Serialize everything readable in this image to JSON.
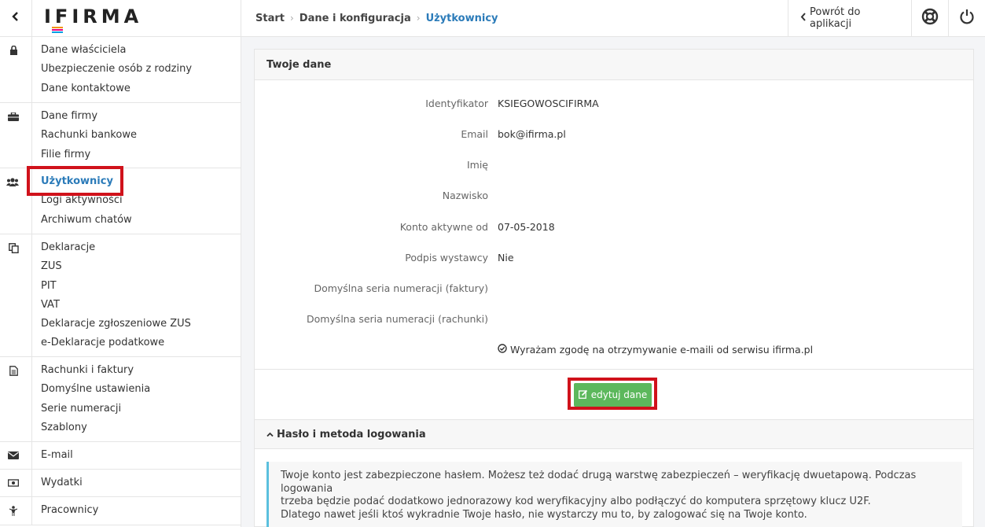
{
  "header": {
    "logo": "IFIRMA",
    "breadcrumb": [
      "Start",
      "Dane i konfiguracja",
      "Użytkownicy"
    ],
    "back_to_app": "Powrót do aplikacji"
  },
  "sidebar": {
    "groups": [
      {
        "icon": "lock-icon",
        "items": [
          "Dane właściciela",
          "Ubezpieczenie osób z rodziny",
          "Dane kontaktowe"
        ]
      },
      {
        "icon": "briefcase-icon",
        "items": [
          "Dane firmy",
          "Rachunki bankowe",
          "Filie firmy"
        ]
      },
      {
        "icon": "users-icon",
        "items": [
          "Użytkownicy",
          "Logi aktywności",
          "Archiwum chatów"
        ]
      },
      {
        "icon": "copy-icon",
        "items": [
          "Deklaracje",
          "ZUS",
          "PIT",
          "VAT",
          "Deklaracje zgłoszeniowe ZUS",
          "e-Deklaracje podatkowe"
        ]
      },
      {
        "icon": "document-icon",
        "items": [
          "Rachunki i faktury",
          "Domyślne ustawienia",
          "Serie numeracji",
          "Szablony"
        ]
      },
      {
        "icon": "envelope-icon",
        "items": [
          "E-mail"
        ]
      },
      {
        "icon": "money-icon",
        "items": [
          "Wydatki"
        ]
      },
      {
        "icon": "person-icon",
        "items": [
          "Pracownicy"
        ]
      }
    ]
  },
  "main": {
    "title": "Twoje dane",
    "fields": [
      {
        "label": "Identyfikator",
        "value": "KSIEGOWOSCIFIRMA"
      },
      {
        "label": "Email",
        "value": "bok@ifirma.pl"
      },
      {
        "label": "Imię",
        "value": ""
      },
      {
        "label": "Nazwisko",
        "value": ""
      },
      {
        "label": "Konto aktywne od",
        "value": "07-05-2018"
      },
      {
        "label": "Podpis wystawcy",
        "value": "Nie"
      },
      {
        "label": "Domyślna seria numeracji (faktury)",
        "value": ""
      },
      {
        "label": "Domyślna seria numeracji (rachunki)",
        "value": ""
      }
    ],
    "consent": "Wyrażam zgodę na otrzymywanie e-maili od serwisu ifirma.pl",
    "edit_button": "edytuj dane",
    "section2_title": "Hasło i metoda logowania",
    "info_lines": [
      "Twoje konto jest zabezpieczone hasłem. Możesz też dodać drugą warstwę zabezpieczeń – weryfikację dwuetapową. Podczas logowania",
      "trzeba będzie podać dodatkowo jednorazowy kod weryfikacyjny albo podłączyć do komputera sprzętowy klucz U2F.",
      "Dlatego nawet jeśli ktoś wykradnie Twoje hasło, nie wystarczy mu to, by zalogować się na Twoje konto."
    ]
  },
  "colors": {
    "accent": "#2b7bb9",
    "button": "#5cb85c",
    "highlight": "#d0121b",
    "info_border": "#5bc0de"
  }
}
